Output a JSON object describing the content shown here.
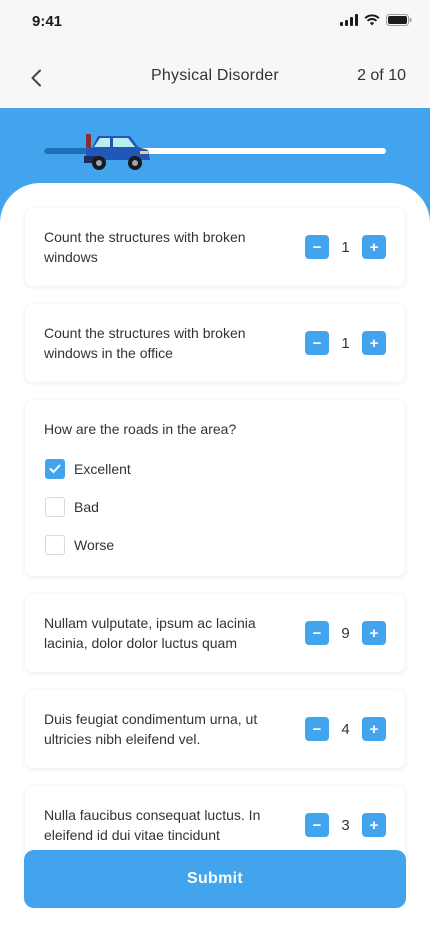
{
  "status": {
    "time": "9:41"
  },
  "header": {
    "title": "Physical Disorder",
    "progress_text": "2 of 10"
  },
  "progress": {
    "fraction": 0.2
  },
  "questions": [
    {
      "text": "Count the structures with broken windows",
      "value": "1"
    },
    {
      "text": "Count the structures with broken windows in the office",
      "value": "1"
    },
    {
      "text": "How are the roads in the area?",
      "options": [
        {
          "label": "Excellent",
          "checked": true
        },
        {
          "label": "Bad",
          "checked": false
        },
        {
          "label": "Worse",
          "checked": false
        }
      ]
    },
    {
      "text": "Nullam vulputate, ipsum ac lacinia lacinia, dolor dolor luctus quam",
      "value": "9"
    },
    {
      "text": "Duis feugiat condimentum urna, ut ultricies nibh eleifend vel.",
      "value": "4"
    },
    {
      "text": "Nulla faucibus consequat luctus. In eleifend id dui vitae tincidunt",
      "value": "3"
    }
  ],
  "stepper": {
    "minus": "−",
    "plus": "+"
  },
  "submit_label": "Submit",
  "colors": {
    "accent": "#42a4ec",
    "track_fill": "#1f6fb8"
  },
  "icons": {
    "back": "chevron-left-icon",
    "car": "car-icon",
    "check": "checkmark-icon"
  }
}
